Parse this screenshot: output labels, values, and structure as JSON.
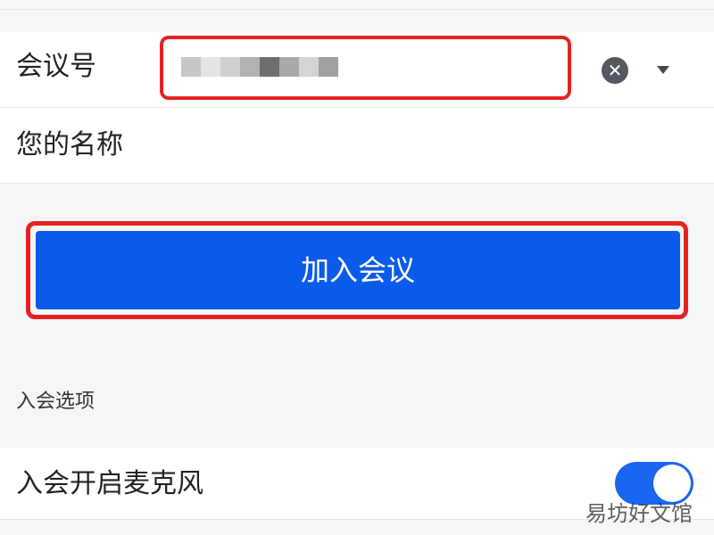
{
  "form": {
    "meeting_id_label": "会议号",
    "name_label": "您的名称"
  },
  "icons": {
    "clear": "clear-circle-icon",
    "dropdown": "dropdown-arrow-icon"
  },
  "actions": {
    "join_label": "加入会议"
  },
  "options": {
    "section_title": "入会选项",
    "mic_label": "入会开启麦克风",
    "mic_enabled": true
  },
  "watermark": "易坊好文馆",
  "colors": {
    "accent": "#0b5bea",
    "highlight_border": "#e52222",
    "toggle_on": "#1a66f0"
  }
}
